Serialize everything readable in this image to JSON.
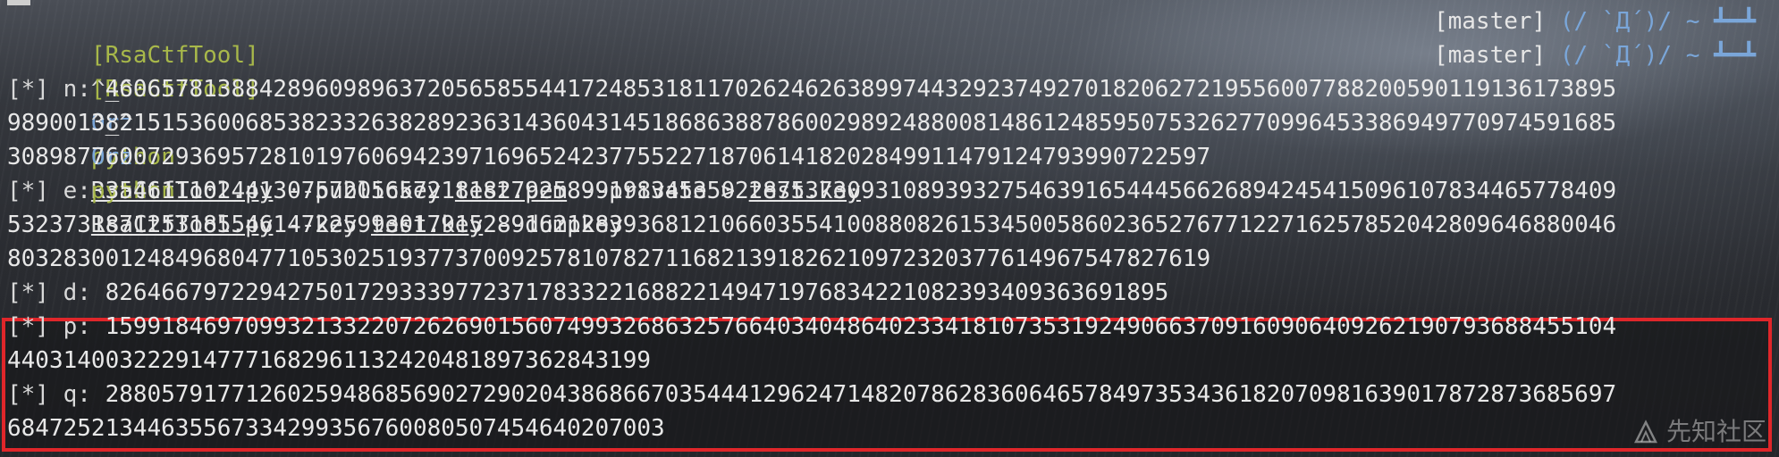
{
  "prompts": [
    {
      "tag": "[RsaCtfTool]",
      "smile": "^_^",
      "orz": "Orz",
      "cmd": "python",
      "parts": [
        {
          "text": "RsaCtfTool.py",
          "underline": true
        },
        {
          "text": " --publickey ",
          "underline": false
        },
        {
          "text": "test.pem",
          "underline": true
        },
        {
          "text": " --private > ",
          "underline": false
        },
        {
          "text": "test.key",
          "underline": true
        }
      ],
      "branch": "[master]",
      "flip": "(/ `Д´)/ ~ ┻━┻"
    },
    {
      "tag": "[RsaCtfTool]",
      "smile": "^_^",
      "orz": "Orz",
      "cmd": "python",
      "parts": [
        {
          "text": "RsaCtfTool.py",
          "underline": true
        },
        {
          "text": " --key ",
          "underline": false
        },
        {
          "text": "test.key",
          "underline": true
        },
        {
          "text": " --dumpkey",
          "underline": false
        }
      ],
      "branch": "[master]",
      "flip": "(/ `Д´)/ ~ ┻━┻"
    }
  ],
  "output": [
    {
      "label": "[*] n: ",
      "lines": [
        "460657813884289609896372056585544172485318117026246263899744329237492701820627219556007788200590119136173895",
        "989001382151536006853823326382892363143604314518686388786002989248800814861248595075326277099645338694977097459168​5",
        "308987760072936957281019760694239716965242377552271870614182028499114791247939907225​97"
      ]
    },
    {
      "label": "[*] e: ",
      "lines": [
        "354611102441307572056572181827925899198345350228753730931089393275463916544456626894245415096107834465778409",
        "532373187125318554614722599301791528916212839368121066035541008808261534500586023652767712271625785204280964688004​6",
        "80328300124849680477105302519377370092578107827116821391826210972320377614967547827619"
      ]
    },
    {
      "label": "[*] d: ",
      "lines": [
        "826466797229427501729333977237178332216882214947197683422108239340936369189​5"
      ]
    },
    {
      "label": "[*] p: ",
      "lines": [
        "159918469709932133220726269015607499326863257664034048640233418107353192490663709160906409262190793688455104",
        "44031400322291477716829611324204818973628431​99"
      ]
    },
    {
      "label": "[*] q: ",
      "lines": [
        "288057917712602594868569027290204386866703544412962471482078628360646578497353436182070981639017872873685697",
        "6847252134463556733429935676008050745464020700​3"
      ]
    }
  ],
  "watermark": "先知社区"
}
